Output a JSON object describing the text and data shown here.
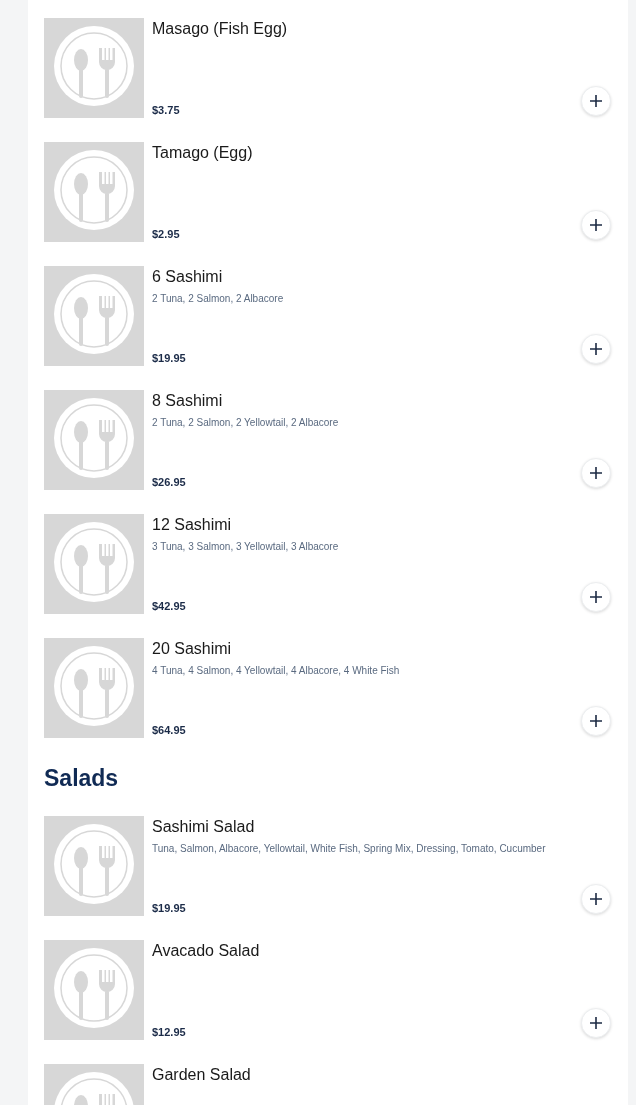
{
  "sections": [
    {
      "items": [
        {
          "name": "Masago (Fish Egg)",
          "price": "$3.75"
        },
        {
          "name": "Tamago (Egg)",
          "price": "$2.95"
        },
        {
          "name": "6 Sashimi",
          "description": "2 Tuna, 2 Salmon, 2 Albacore",
          "price": "$19.95"
        },
        {
          "name": "8 Sashimi",
          "description": "2 Tuna, 2 Salmon, 2 Yellowtail, 2 Albacore",
          "price": "$26.95"
        },
        {
          "name": "12 Sashimi",
          "description": "3 Tuna, 3 Salmon, 3 Yellowtail, 3 Albacore",
          "price": "$42.95"
        },
        {
          "name": "20 Sashimi",
          "description": "4 Tuna, 4 Salmon, 4 Yellowtail, 4 Albacore, 4 White Fish",
          "price": "$64.95"
        }
      ]
    },
    {
      "title": "Salads",
      "items": [
        {
          "name": "Sashimi Salad",
          "description": "Tuna, Salmon, Albacore, Yellowtail, White Fish, Spring Mix, Dressing, Tomato, Cucumber",
          "price": "$19.95"
        },
        {
          "name": "Avacado Salad",
          "price": "$12.95"
        },
        {
          "name": "Garden Salad"
        }
      ]
    }
  ]
}
